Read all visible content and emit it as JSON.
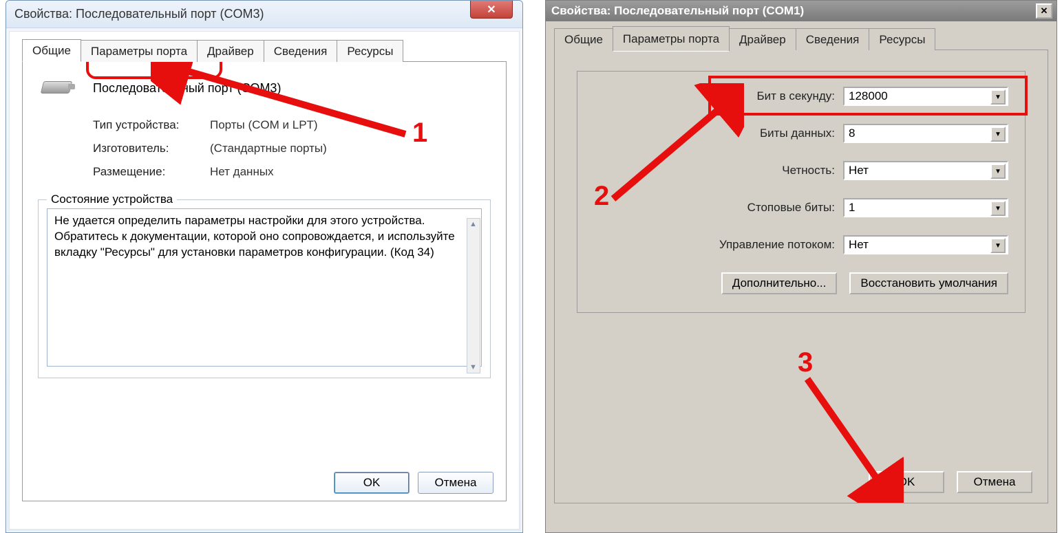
{
  "left": {
    "title": "Свойства: Последовательный порт (COM3)",
    "tabs": [
      "Общие",
      "Параметры порта",
      "Драйвер",
      "Сведения",
      "Ресурсы"
    ],
    "device_name": "Последовательный порт (COM3)",
    "rows": {
      "type_label": "Тип устройства:",
      "type_value": "Порты (COM и LPT)",
      "mfr_label": "Изготовитель:",
      "mfr_value": "(Стандартные порты)",
      "loc_label": "Размещение:",
      "loc_value": "Нет данных"
    },
    "status_legend": "Состояние устройства",
    "status_text": "Не удается определить параметры настройки для этого устройства. Обратитесь к документации, которой оно сопровождается, и используйте вкладку \"Ресурсы\" для установки параметров конфигурации. (Код 34)",
    "ok": "OK",
    "cancel": "Отмена"
  },
  "right": {
    "title": "Свойства: Последовательный порт (COM1)",
    "tabs": [
      "Общие",
      "Параметры порта",
      "Драйвер",
      "Сведения",
      "Ресурсы"
    ],
    "fields": {
      "bps_label": "Бит в секунду:",
      "bps_value": "128000",
      "data_label": "Биты данных:",
      "data_value": "8",
      "parity_label": "Четность:",
      "parity_value": "Нет",
      "stop_label": "Стоповые биты:",
      "stop_value": "1",
      "flow_label": "Управление потоком:",
      "flow_value": "Нет"
    },
    "advanced": "Дополнительно...",
    "restore": "Восстановить умолчания",
    "ok": "OK",
    "cancel": "Отмена"
  },
  "annotations": {
    "n1": "1",
    "n2": "2",
    "n3": "3"
  }
}
